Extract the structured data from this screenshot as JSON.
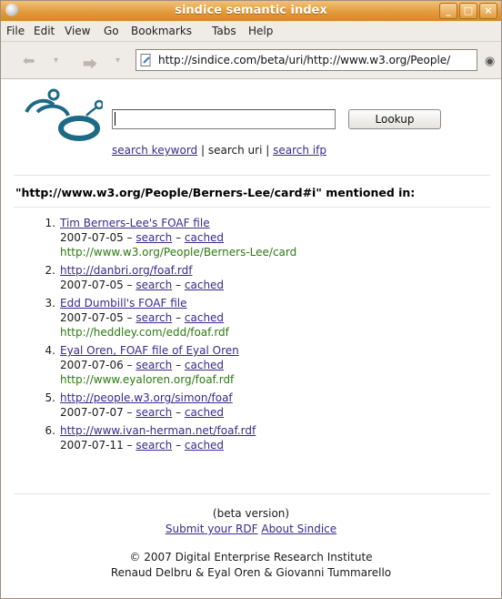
{
  "window": {
    "title": "sindice semantic index",
    "controls": [
      "_",
      "□",
      "×"
    ]
  },
  "menu": [
    "File",
    "Edit",
    "View",
    "Go",
    "Bookmarks",
    "Tabs",
    "Help"
  ],
  "toolbar": {
    "url": "http://sindice.com/beta/uri/http://www.w3.org/People/"
  },
  "search": {
    "value": "",
    "button": "Lookup"
  },
  "modes": {
    "keyword": "search keyword",
    "sep1": " | ",
    "uri": "search uri",
    "sep2": " | ",
    "ifp": "search ifp"
  },
  "heading": "\"http://www.w3.org/People/Berners-Lee/card#i\"  mentioned in:",
  "results": [
    {
      "n": "1.",
      "title": "Tim Berners-Lee's FOAF file",
      "date": "2007-07-05 – ",
      "search": "search",
      "dash": " – ",
      "cached": "cached",
      "url": "http://www.w3.org/People/Berners-Lee/card"
    },
    {
      "n": "2.",
      "title": "http://danbri.org/foaf.rdf",
      "date": "2007-07-05 – ",
      "search": "search",
      "dash": " – ",
      "cached": "cached",
      "url": ""
    },
    {
      "n": "3.",
      "title": "Edd Dumbill's FOAF file",
      "date": "2007-07-05 – ",
      "search": "search",
      "dash": " – ",
      "cached": "cached",
      "url": "http://heddley.com/edd/foaf.rdf"
    },
    {
      "n": "4.",
      "title": "Eyal Oren, FOAF file of Eyal Oren",
      "date": "2007-07-06 – ",
      "search": "search",
      "dash": " – ",
      "cached": "cached",
      "url": "http://www.eyaloren.org/foaf.rdf"
    },
    {
      "n": "5.",
      "title": "http://people.w3.org/simon/foaf",
      "date": "2007-07-07 – ",
      "search": "search",
      "dash": " – ",
      "cached": "cached",
      "url": ""
    },
    {
      "n": "6.",
      "title": "http://www.ivan-herman.net/foaf.rdf",
      "date": "2007-07-11 – ",
      "search": "search",
      "dash": " – ",
      "cached": "cached",
      "url": ""
    }
  ],
  "footer": {
    "beta": "(beta version)",
    "submit": "Submit your RDF",
    "about": "About Sindice",
    "copyright": "© 2007 Digital Enterprise Research Institute",
    "authors": "Renaud Delbru & Eyal Oren & Giovanni Tummarello"
  },
  "colors": {
    "title_bar": "#e39a3c",
    "link": "#3a2a8c",
    "url_green": "#2c7a10",
    "logo_teal": "#1d6a86"
  }
}
